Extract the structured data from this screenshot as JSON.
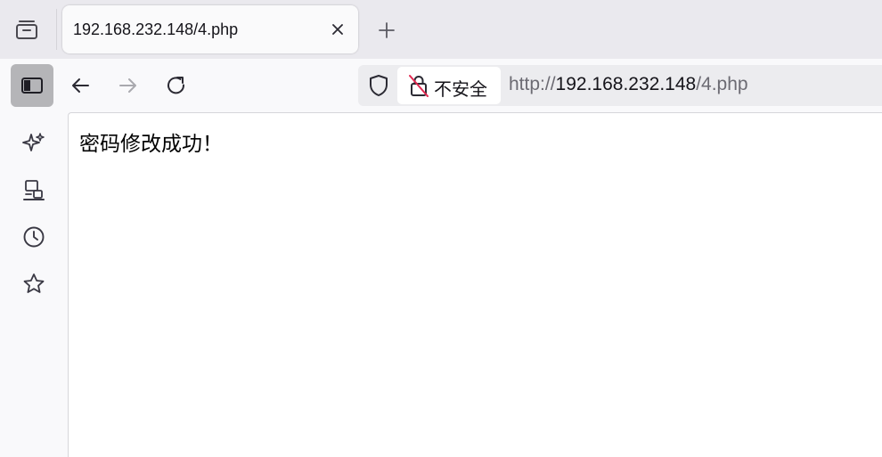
{
  "tab": {
    "title": "192.168.232.148/4.php",
    "close_icon": "close-icon"
  },
  "toolbar": {
    "tabs_icon": "tab-overview-icon",
    "new_tab_icon": "plus-icon",
    "sidebar_icon": "sidebar-toggle-icon",
    "back_icon": "arrow-left-icon",
    "forward_icon": "arrow-right-icon",
    "reload_icon": "reload-icon"
  },
  "urlbar": {
    "shield_icon": "shield-icon",
    "insecure_label": "不安全",
    "insecure_icon": "insecure-lock-icon",
    "scheme": "http://",
    "host": "192.168.232.148",
    "path": "/4.php"
  },
  "sidebar": {
    "items": [
      {
        "icon": "ai-sparkle-icon"
      },
      {
        "icon": "synced-devices-icon"
      },
      {
        "icon": "history-clock-icon"
      },
      {
        "icon": "bookmark-star-icon"
      }
    ]
  },
  "page": {
    "message": "密码修改成功！"
  },
  "colors": {
    "tabstrip": "#eae9ee",
    "toolbar": "#f9f9fb",
    "urlbar": "#ececef",
    "sidebar_toggle_active": "#b5b5b8",
    "insecure_slash": "#e22850"
  }
}
